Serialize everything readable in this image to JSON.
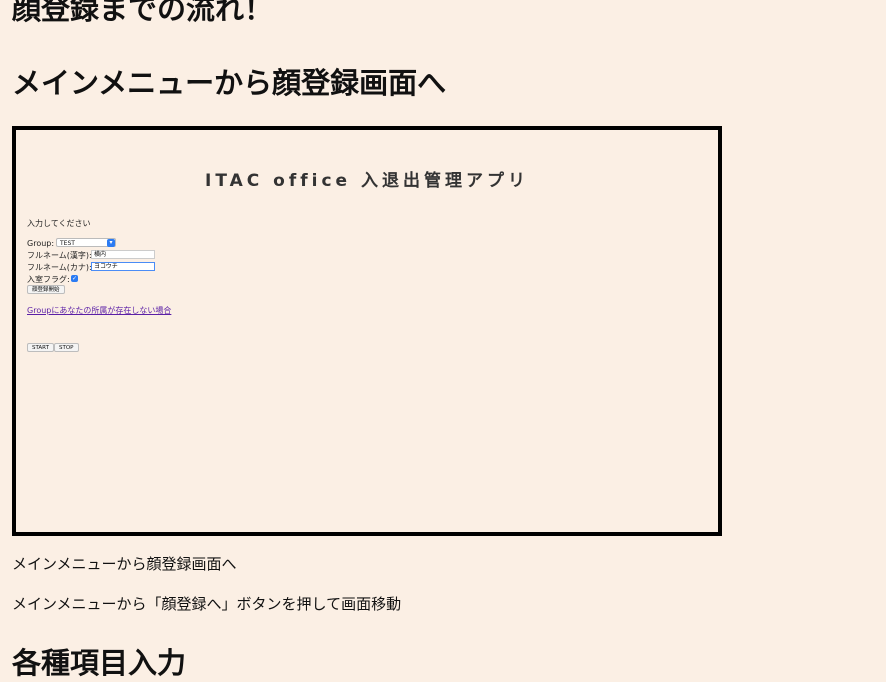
{
  "page": {
    "heading_flow": "顔登録までの流れ！",
    "section1_title": "メインメニューから顔登録画面へ",
    "caption1": "メインメニューから顔登録画面へ",
    "caption2": "メインメニューから「顔登録へ」ボタンを押して画面移動",
    "section2_title": "各種項目入力"
  },
  "screenshot": {
    "app_title": "ITAC office 入退出管理アプリ",
    "prompt": "入力してください",
    "group_label": "Group:",
    "group_value": "TEST",
    "kanji_label": "フルネーム(漢字):",
    "kanji_value": "横内",
    "kana_label": "フルネーム(カナ):",
    "kana_value": "ヨコウチ",
    "flag_label": "入室フラグ:",
    "flag_checked": true,
    "register_button": "顔登録開始",
    "group_missing_link": "Groupにあなたの所属が存在しない場合",
    "start_button": "START",
    "stop_button": "STOP"
  },
  "colors": {
    "background": "#fbefe4",
    "border": "#000000",
    "link": "#5b1fa6",
    "accent": "#2b7bf3"
  }
}
